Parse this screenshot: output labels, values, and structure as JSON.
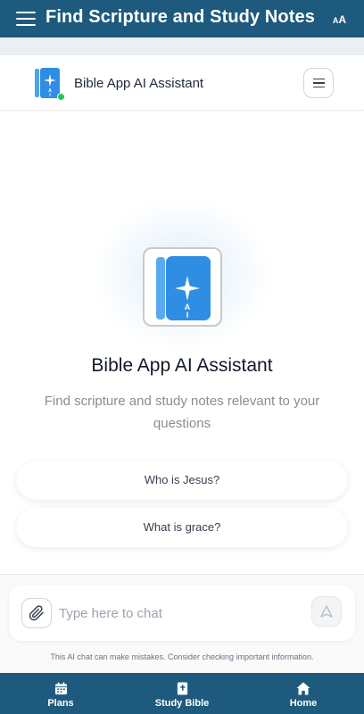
{
  "topbar": {
    "title": "Find Scripture and Study Notes",
    "font_size_small": "A",
    "font_size_big": "A",
    "color": "#1e5a7d"
  },
  "chat_header": {
    "title": "Bible App AI Assistant",
    "logo_icon": "bible-ai-book-icon",
    "status": "online",
    "status_color": "#22c55e"
  },
  "hero": {
    "title": "Bible App AI Assistant",
    "subtitle": "Find scripture and study notes relevant to your questions",
    "logo_letters": "AI",
    "accent_color": "#2f8de4"
  },
  "suggestions": [
    {
      "label": "Who is Jesus?"
    },
    {
      "label": "What is grace?"
    }
  ],
  "composer": {
    "placeholder": "Type here to chat",
    "value": "",
    "disclaimer": "This AI chat can make mistakes. Consider checking important information."
  },
  "bottom_nav": {
    "items": [
      {
        "label": "Plans",
        "icon": "calendar-icon"
      },
      {
        "label": "Study Bible",
        "icon": "bible-icon"
      },
      {
        "label": "Home",
        "icon": "home-icon"
      }
    ]
  }
}
